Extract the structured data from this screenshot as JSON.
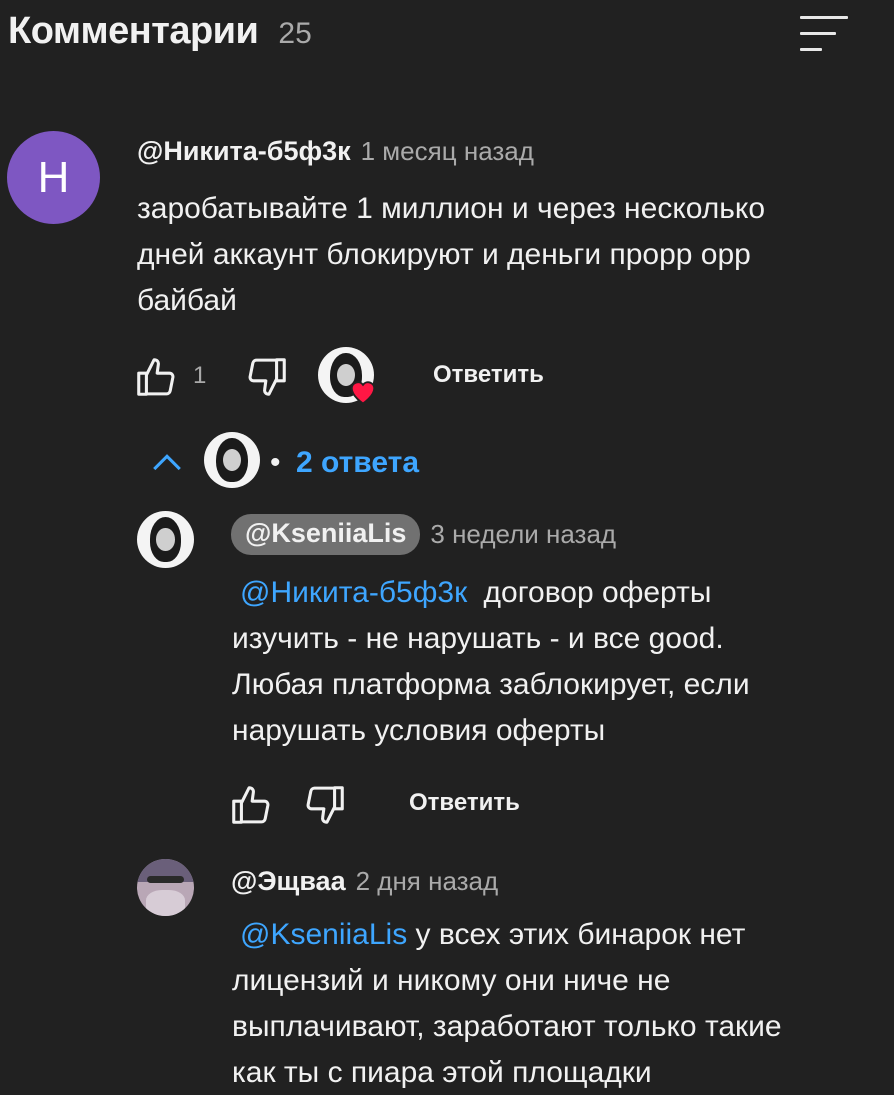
{
  "header": {
    "title": "Комментарии",
    "count": "25",
    "sort_icon": "sort-icon"
  },
  "comment": {
    "avatar_letter": "Н",
    "author": "@Никита-б5ф3к",
    "time": "1 месяц назад",
    "text_lines": [
      "заробатывайте 1 миллион и через несколько",
      "дней аккаунт блокируют и деньги прорр орр",
      "байбай"
    ],
    "likes": "1",
    "reply_label": "Ответить",
    "creator_heart": "heart-icon"
  },
  "replies_toggle": {
    "label": "2 ответа",
    "separator": "•"
  },
  "reply1": {
    "author": "@KseniiaLis",
    "time": "3 недели назад",
    "mention": "@Никита-б5ф3к",
    "text_first": "договор оферты",
    "text_lines": [
      "изучить - не нарушать - и все good.",
      "Любая платформа заблокирует, если",
      "нарушать условия оферты"
    ],
    "reply_label": "Ответить"
  },
  "reply2": {
    "author": "@Эщваа",
    "time": "2 дня назад",
    "mention": "@KseniiaLis",
    "text_first": "у всех этих бинарок нет",
    "text_lines": [
      "лицензий и никому они ниче не",
      "выплачивают, заработают только такие",
      "как ты с пиара этой площадки"
    ]
  },
  "colors": {
    "background": "#212121",
    "link": "#3ea6ff",
    "avatar_purple": "#7e57c2",
    "heart": "#ff1744"
  }
}
